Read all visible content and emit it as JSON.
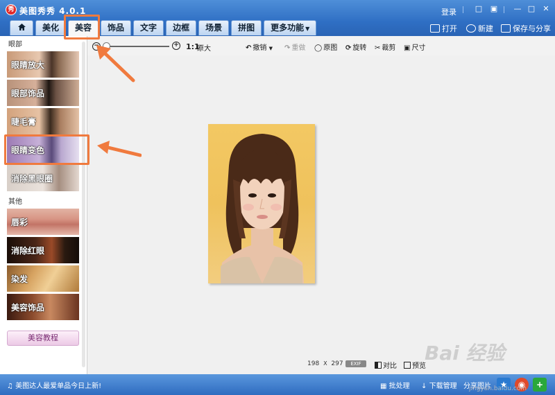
{
  "app": {
    "title": "美图秀秀 4.0.1",
    "logo_text": "秀",
    "login": "登录"
  },
  "titlebar_icons": [
    "message-icon",
    "skin-icon",
    "minimize-icon",
    "maximize-icon",
    "close-icon"
  ],
  "tabs": [
    {
      "label": "",
      "icon": "home-icon"
    },
    {
      "label": "美化"
    },
    {
      "label": "美容",
      "active": true
    },
    {
      "label": "饰品"
    },
    {
      "label": "文字"
    },
    {
      "label": "边框"
    },
    {
      "label": "场景"
    },
    {
      "label": "拼图"
    },
    {
      "label": "更多功能"
    }
  ],
  "actions": {
    "open": "打开",
    "new": "新建",
    "save_share": "保存与分享"
  },
  "sidebar": {
    "section_eyes": "眼部",
    "section_other": "其他",
    "features": [
      {
        "label": "眼睛放大"
      },
      {
        "label": "眼部饰品"
      },
      {
        "label": "睫毛膏"
      },
      {
        "label": "眼睛变色"
      },
      {
        "label": "消除黑眼圈"
      },
      {
        "label": "唇彩"
      },
      {
        "label": "消除红眼"
      },
      {
        "label": "染发"
      },
      {
        "label": "美容饰品"
      }
    ],
    "tutorial": "美容教程"
  },
  "toolbar": {
    "ratio": "1:1",
    "original_size": "原大",
    "undo": "撤销",
    "redo": "重做",
    "original": "原图",
    "rotate": "旋转",
    "crop": "裁剪",
    "size": "尺寸"
  },
  "canvas": {
    "width_px": "198",
    "times": "X",
    "height_px": "297",
    "exif": "EXIF",
    "compare": "对比",
    "preview": "预览"
  },
  "bottom": {
    "news": "美图达人最爱单品今日上新!",
    "batch": "批处理",
    "download": "下载管理",
    "share_photo": "分享图片"
  },
  "watermark": {
    "brand": "Bai 经验",
    "url": "jingyan.baidu.com"
  },
  "colors": {
    "titlebar": "#2f6fc4",
    "highlight": "#f07a3e"
  }
}
